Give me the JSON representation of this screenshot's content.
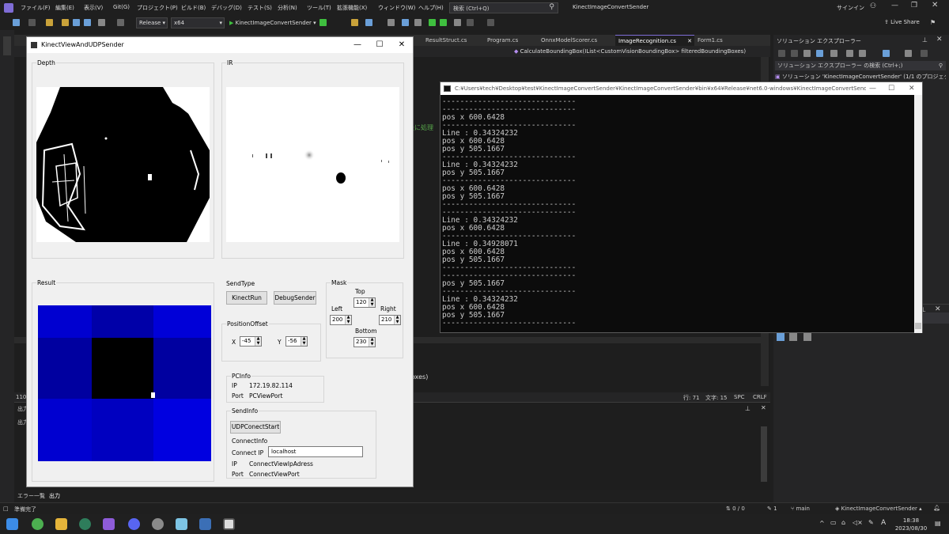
{
  "menu": {
    "items": [
      "ファイル(F)",
      "編集(E)",
      "表示(V)",
      "Git(G)",
      "プロジェクト(P)",
      "ビルド(B)",
      "デバッグ(D)",
      "テスト(S)",
      "分析(N)",
      "ツール(T)",
      "拡張機能(X)",
      "ウィンドウ(W)",
      "ヘルプ(H)"
    ],
    "search_placeholder": "検索 (Ctrl+Q)",
    "solution_title": "KinectImageConvertSender",
    "signin": "サインイン"
  },
  "toolbar": {
    "configuration": "Release",
    "platform": "x64",
    "start_target": "KinectImageConvertSender",
    "live_share": "Live Share"
  },
  "editor": {
    "tabs": [
      "ResultStruct.cs",
      "Program.cs",
      "OnnxModelScorer.cs",
      "ImageRecognition.cs",
      "Form1.cs"
    ],
    "active_tab": "ImageRecognition.cs",
    "nav_member": "CalculateBoundingBox(IList<CustomVisionBoundingBox> filteredBoundingBoxes)",
    "snippet_comment": "後に処理",
    "snippet_code": "oxes)",
    "status": {
      "zoom": "110",
      "line": "行: 71",
      "char": "文字: 15",
      "spc": "SPC",
      "crlf": "CRLF"
    }
  },
  "output_panel": {
    "title": "出力",
    "left_label": "出力"
  },
  "bottom_tabs": [
    "エラー一覧",
    "出力"
  ],
  "solution_explorer": {
    "title": "ソリューション エクスプローラー",
    "search_placeholder": "ソリューション エクスプローラー の検索 (Ctrl+;)",
    "root_item": "ソリューション 'KinectImageConvertSender' (1/1 のプロジェクト)"
  },
  "statusbar": {
    "ready": "準備完了",
    "changes": "0 / 0",
    "commits": "1",
    "branch": "main",
    "repo": "KinectImageConvertSender"
  },
  "taskbar": {
    "time": "18:38",
    "date": "2023/08/30",
    "ime": "A"
  },
  "console": {
    "title": "C:¥Users¥tech¥Desktop¥test¥KinectImageConvertSender¥KinectImageConvertSender¥bin¥x64¥Release¥net6.0-windows¥KinectImageConvertSender.exe",
    "lines": [
      "------------------------------",
      "------------------------------",
      "pos x 600.6428",
      "------------------------------",
      "Line : 0.34324232",
      "pos x 600.6428",
      "pos y 505.1667",
      "------------------------------",
      "Line : 0.34324232",
      "pos y 505.1667",
      "------------------------------",
      "pos x 600.6428",
      "pos y 505.1667",
      "------------------------------",
      "------------------------------",
      "Line : 0.34324232",
      "pos x 600.6428",
      "------------------------------",
      "Line : 0.34928071",
      "pos x 600.6428",
      "pos y 505.1667",
      "------------------------------",
      "------------------------------",
      "pos y 505.1667",
      "------------------------------",
      "Line : 0.34324232",
      "pos x 600.6428",
      "pos y 505.1667",
      "------------------------------"
    ]
  },
  "form": {
    "title": "KinectViewAndUDPSender",
    "depth_label": "Depth",
    "ir_label": "IR",
    "result_label": "Result",
    "sendtype": {
      "label": "SendType",
      "kinect_run": "KinectRun",
      "debug_sender": "DebugSender"
    },
    "position_offset": {
      "label": "PositionOffset",
      "x_label": "X",
      "x_value": "-45",
      "y_label": "Y",
      "y_value": "-56"
    },
    "mask": {
      "label": "Mask",
      "top_label": "Top",
      "top_value": "120",
      "left_label": "Left",
      "left_value": "200",
      "right_label": "Right",
      "right_value": "210",
      "bottom_label": "Bottom",
      "bottom_value": "230"
    },
    "pcinfo": {
      "label": "PCInfo",
      "ip_label": "IP",
      "ip_value": "172.19.82.114",
      "port_label": "Port",
      "port_value": "PCViewPort"
    },
    "sendinfo": {
      "label": "SendInfo",
      "start_button": "UDPConectStart",
      "connectinfo_label": "ConnectInfo",
      "connect_ip_label": "Connect IP",
      "connect_ip_value": "localhost",
      "ip_label": "IP",
      "ip_value": "ConnectViewIpAdress",
      "port_label": "Port",
      "port_value": "ConnectViewPort"
    }
  },
  "result_grid": {
    "colors": [
      "#0000d0",
      "#0000a8",
      "#0000d8",
      "#0000a0",
      "#000000",
      "#0000a0",
      "#0000d0",
      "#0000c0",
      "#0000e0"
    ]
  }
}
